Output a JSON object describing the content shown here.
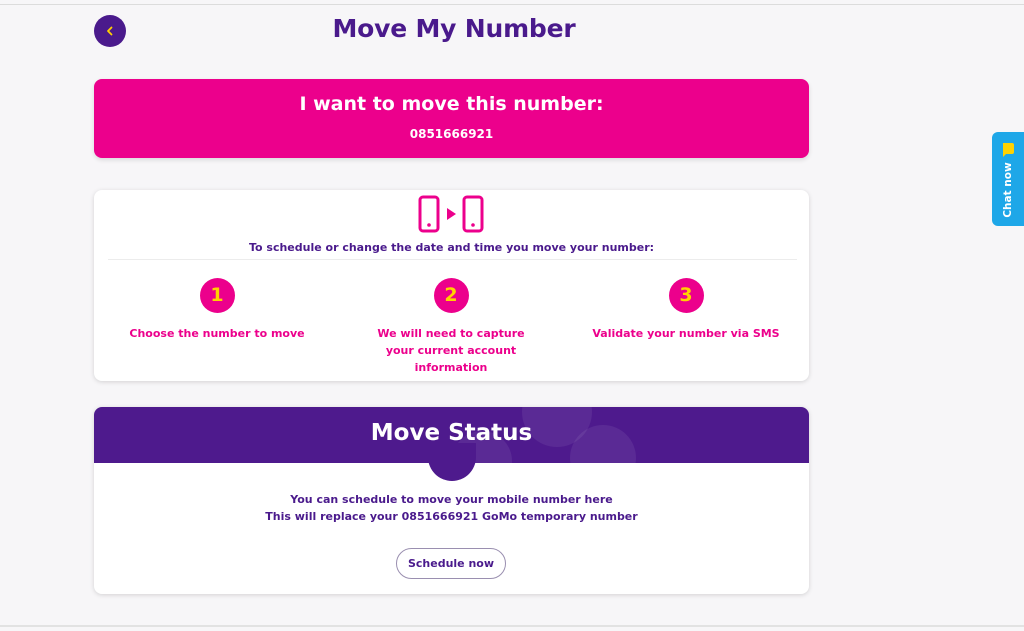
{
  "header": {
    "title": "Move My Number",
    "back_icon": "chevron-left-icon"
  },
  "number_card": {
    "heading": "I want to move this number:",
    "number": "0851666921"
  },
  "steps_card": {
    "icon": "phone-transfer-icon",
    "intro": "To schedule or change the date and time you move your number:",
    "steps": [
      {
        "number": "1",
        "label": "Choose the number to move"
      },
      {
        "number": "2",
        "label": "We will need to capture your current account information"
      },
      {
        "number": "3",
        "label": "Validate your number via SMS"
      }
    ]
  },
  "status_card": {
    "title": "Move Status",
    "line1": "You can schedule to move your mobile number here",
    "line2": "This will replace your 0851666921 GoMo temporary number",
    "button_label": "Schedule now"
  },
  "chat": {
    "label": "Chat now",
    "icon": "chat-bubble-icon"
  },
  "colors": {
    "brand_purple": "#4a1a8c",
    "brand_pink": "#ec008c",
    "accent_yellow": "#ffd200",
    "chat_blue": "#1ea7e8"
  }
}
